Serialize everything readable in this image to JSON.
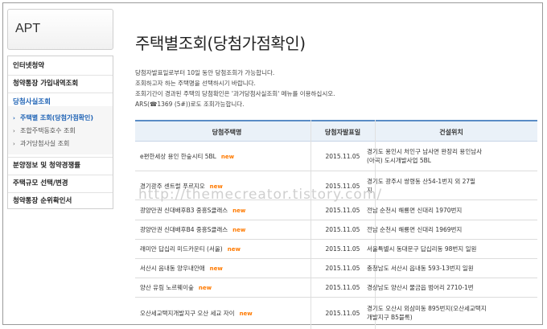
{
  "logo": {
    "label": "APT"
  },
  "sidebar": {
    "items": [
      {
        "label": "인터넷청약"
      },
      {
        "label": "청약통장 가입내역조회"
      },
      {
        "label": "당첨사실조회"
      },
      {
        "label": "분양정보 및 청약경쟁률"
      },
      {
        "label": "주택규모 선택/변경"
      },
      {
        "label": "청약통장 순위확인서"
      }
    ],
    "subitems": [
      {
        "label": "주택별 조회(당첨가점확인)"
      },
      {
        "label": "조합주택동호수 조회"
      },
      {
        "label": "과거당첨사실 조회"
      }
    ]
  },
  "main": {
    "title": "주택별조회(당첨가점확인)",
    "desc": [
      "당첨자발표일로부터 10일 동안 당첨조회가 가능합니다.",
      "조회하고자 하는 주택명을 선택하시기 바랍니다.",
      "조회기간이 경과된 주택의 당첨확인은 '과거당첨사실조회' 메뉴를 이용하십시오.",
      "ARS(☎1369 (5#))로도 조회가능합니다."
    ]
  },
  "table": {
    "headers": {
      "name": "당첨주택명",
      "date": "당첨자발표일",
      "loc": "건설위치"
    },
    "new_label": "new",
    "rows": [
      {
        "name": "e편한세상 용인 한숲시티 5BL",
        "date": "2015.11.05",
        "loc1": "경기도 용인시 처인구 남사면 완장리 용인남사",
        "loc2": "(아곡) 도시개발사업 5BL"
      },
      {
        "name": "경기광주 센트럴 푸르지오",
        "date": "2015.11.05",
        "loc1": "경기도 광주시 쌍령동 산54-1번지 외 27필",
        "loc2": "지"
      },
      {
        "name": "광양만권 신대배후B3 중흥S클래스",
        "date": "2015.11.05",
        "loc1": "전남 순천시 해룡면 신대리 1970번지",
        "loc2": ""
      },
      {
        "name": "광양만권 신대배후B4 중흥S클래스",
        "date": "2015.11.05",
        "loc1": "전남 순천시 해룡면 신대리 1969번지",
        "loc2": ""
      },
      {
        "name": "래미안 답십리 미드카운티 (서울)",
        "date": "2015.11.05",
        "loc1": "서울특별시 동대문구 답십리동 98번지 일원",
        "loc2": ""
      },
      {
        "name": "서산시 음내동 양우내안애",
        "date": "2015.11.05",
        "loc1": "충청남도 서산시 읍내동 593-13번지 일원",
        "loc2": ""
      },
      {
        "name": "양산 유림 노르웨이숲",
        "date": "2015.11.05",
        "loc1": "경상남도 양산시 물금읍 범어리 2710-1번",
        "loc2": ""
      },
      {
        "name": "오산세교택지개발지구 오산 세교 자이",
        "date": "2015.11.05",
        "loc1": "경기도 오산시 외삼미동 895번지(오산세교택지",
        "loc2": "개발지구 B5블록)"
      }
    ]
  },
  "watermark": "http://themecreator.tistory.com/"
}
